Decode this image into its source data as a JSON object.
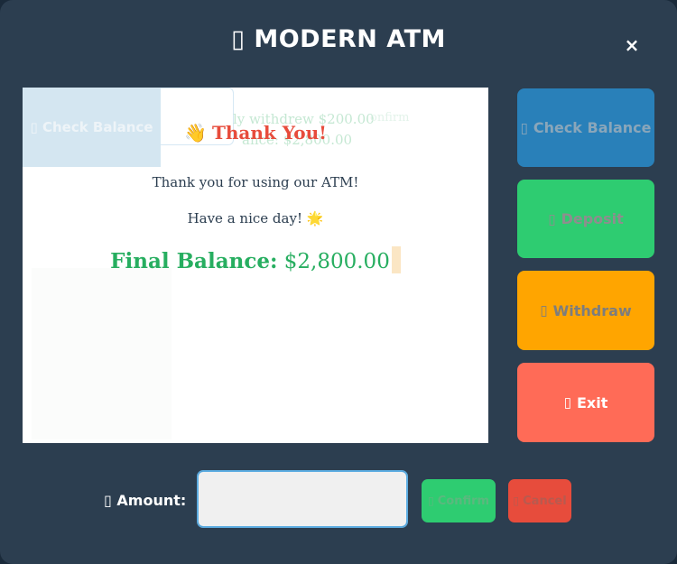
{
  "window": {
    "title": "MODERN ATM",
    "title_icon": "▯",
    "close_label": "×"
  },
  "screen": {
    "ghost": {
      "check_balance": "▯ Check Balance",
      "line_a": "ly withdrew $200.00",
      "line_b": "ance: $2,800.00",
      "confirm_fragment": "onfirm"
    },
    "thank_you": {
      "icon": "👋",
      "title": "Thank You!",
      "message": "Thank you for using our ATM!",
      "farewell": "Have a nice day! 🌟",
      "final_label": "Final Balance:",
      "final_value": "$2,800.00"
    }
  },
  "sidebar": {
    "check_balance": {
      "icon": "▯",
      "label": "Check Balance"
    },
    "deposit": {
      "icon": "▯",
      "label": "Deposit"
    },
    "withdraw": {
      "icon": "▯",
      "label": "Withdraw"
    },
    "exit": {
      "icon": "▯",
      "label": "Exit"
    }
  },
  "footer": {
    "amount_icon": "▯",
    "amount_label": "Amount:",
    "amount_value": "",
    "confirm": {
      "icon": "▯",
      "label": "Confirm"
    },
    "cancel": {
      "icon": "▯",
      "label": "Cancel"
    }
  },
  "colors": {
    "background": "#2c3e50",
    "check_balance": "#2980b9",
    "deposit": "#2ecc71",
    "withdraw": "#ffa500",
    "exit": "#ff6b57",
    "cancel": "#e74c3c",
    "success_text": "#27ae60",
    "title_red": "#e74c3c"
  }
}
